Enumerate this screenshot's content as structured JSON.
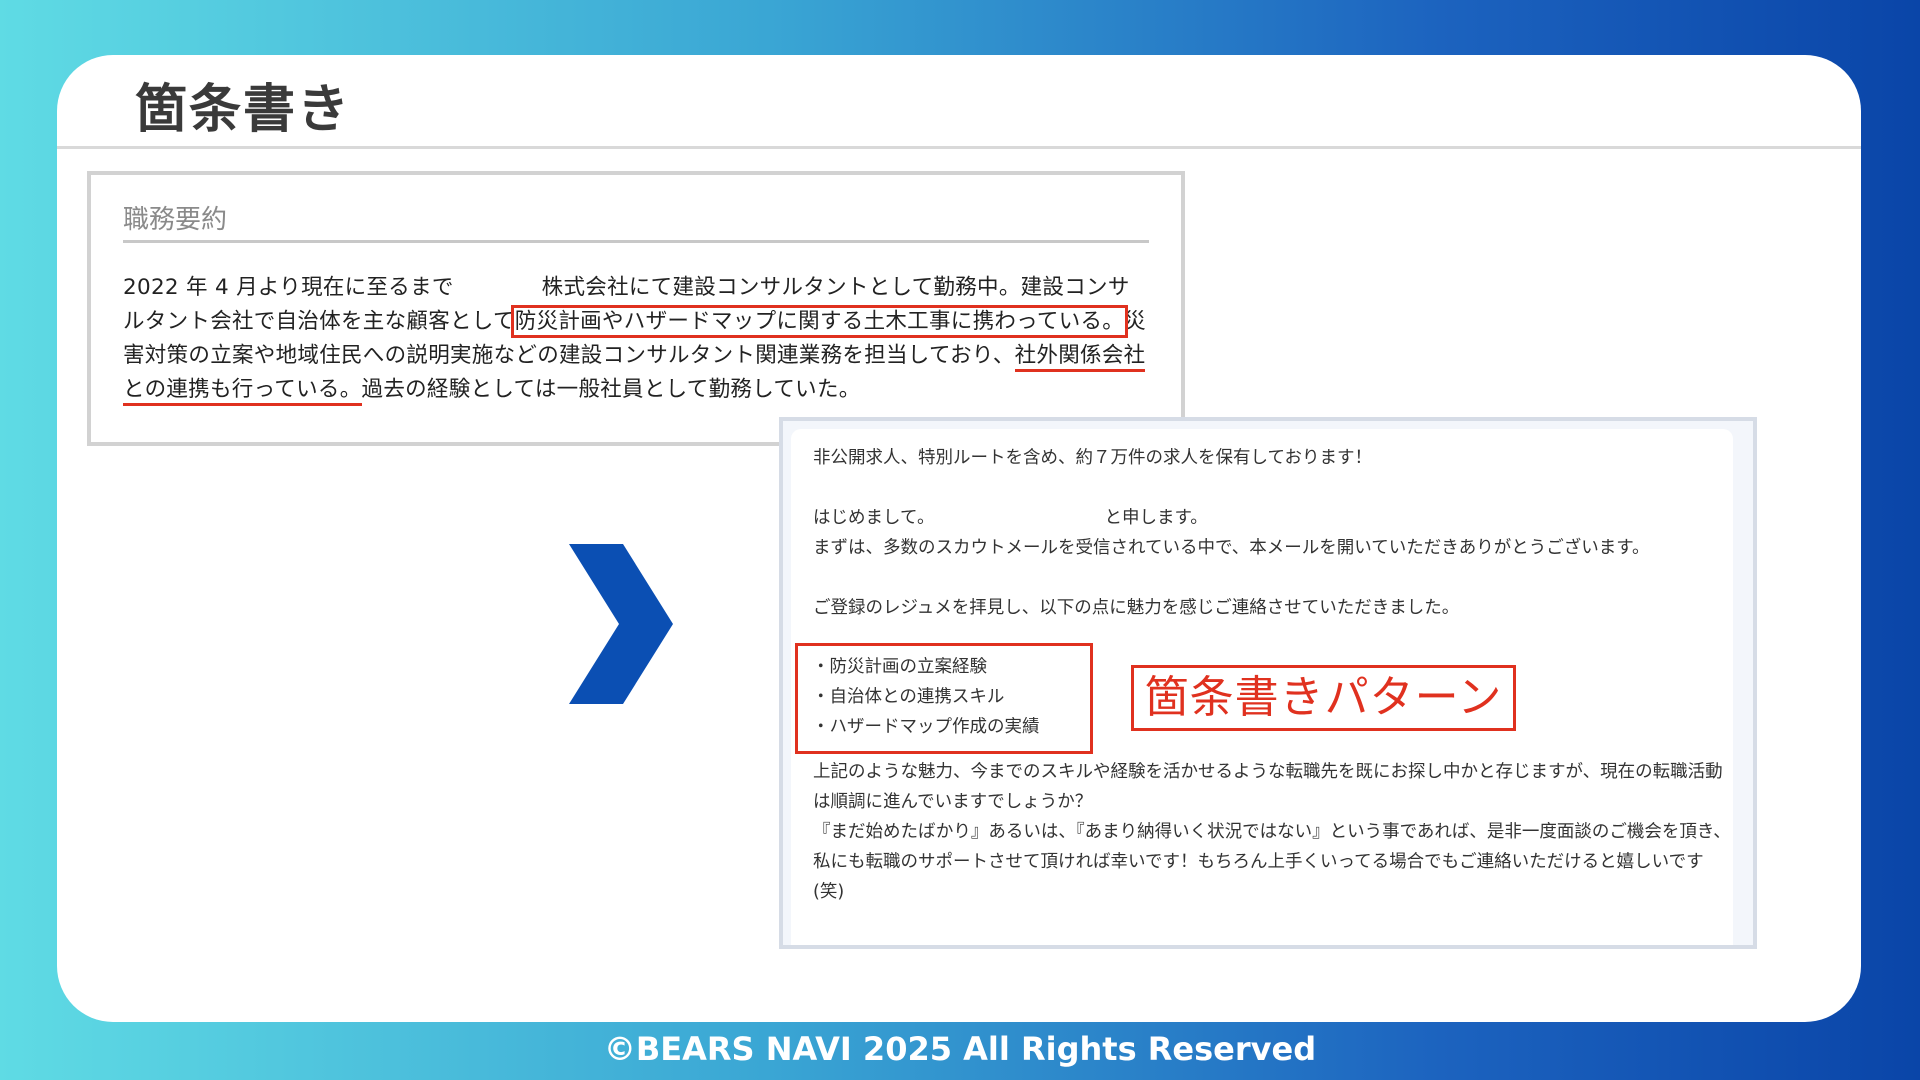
{
  "slide": {
    "title": "箇条書き",
    "footer": "©BEARS NAVI 2025 All Rights Reserved"
  },
  "summary": {
    "heading": "職務要約",
    "text_1": "2022 年 4 月より現在に至るまで",
    "text_2": "株式会社にて建設コンサルタントとして勤務中。建設コンサルタント会社で自治体を主な顧客として",
    "highlight_1": "防災計画やハザードマップに関する土木工事に携わっている。",
    "text_3": "災害対策の立案や地域住民への説明実施などの建設コンサルタント関連業務を担当しており、",
    "highlight_2": "社外関係会社との連携も行っている。",
    "text_4": "過去の経験としては一般社員として勤務していた。"
  },
  "email": {
    "line_1": "非公開求人、特別ルートを含め、約７万件の求人を保有しております！",
    "line_2a": "はじめまして。",
    "line_2b": "と申します。",
    "line_3": "まずは、多数のスカウトメールを受信されている中で、本メールを開いていただきありがとうございます。",
    "line_4": "ご登録のレジュメを拝見し、以下の点に魅力を感じご連絡させていただきました。",
    "bullets": [
      "・防災計画の立案経験",
      "・自治体との連携スキル",
      "・ハザードマップ作成の実績"
    ],
    "line_5": "上記のような魅力、今までのスキルや経験を活かせるような転職先を既にお探し中かと存じますが、現在の転職活動は順調に進んでいますでしょうか？",
    "line_6": "『まだ始めたばかり』あるいは、『あまり納得いく状況ではない』という事であれば、是非一度面談のご機会を頂き、私にも転職のサポートさせて頂ければ幸いです！もちろん上手くいってる場合でもご連絡いただけると嬉しいです(笑)"
  },
  "annotation": {
    "label": "箇条書きパターン",
    "color": "#e0311f"
  },
  "icons": {
    "arrow": "chevron-right-icon"
  }
}
